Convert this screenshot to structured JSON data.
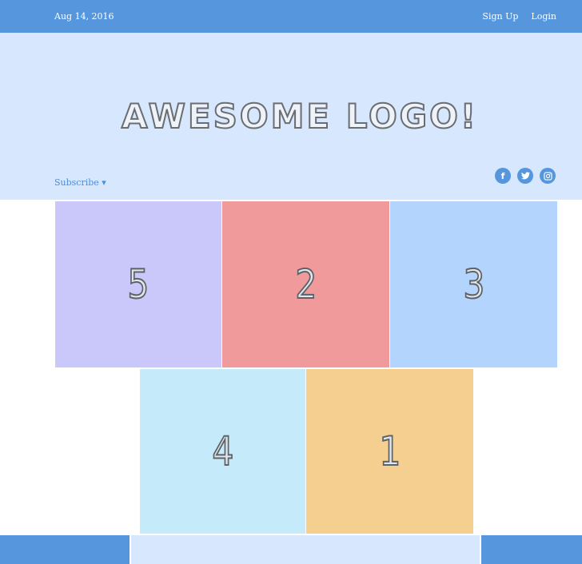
{
  "topbar": {
    "date": "Aug 14, 2016",
    "signup_label": "Sign Up",
    "login_label": "Login"
  },
  "header": {
    "logo_text": "AWESOME LOGO!",
    "subscribe_label": "Subscribe ▾",
    "socials": [
      {
        "icon": "facebook-icon",
        "glyph": "f"
      },
      {
        "icon": "twitter-icon"
      },
      {
        "icon": "instagram-icon"
      }
    ]
  },
  "tiles": [
    {
      "label": "5",
      "color": "#cac7fb"
    },
    {
      "label": "2",
      "color": "#f19a9c"
    },
    {
      "label": "3",
      "color": "#b3d4fd"
    },
    {
      "label": "4",
      "color": "#c5ebfa"
    },
    {
      "label": "1",
      "color": "#f4cf8f"
    }
  ],
  "colors": {
    "primary": "#5596dc",
    "header_bg": "#d6e7fe"
  }
}
